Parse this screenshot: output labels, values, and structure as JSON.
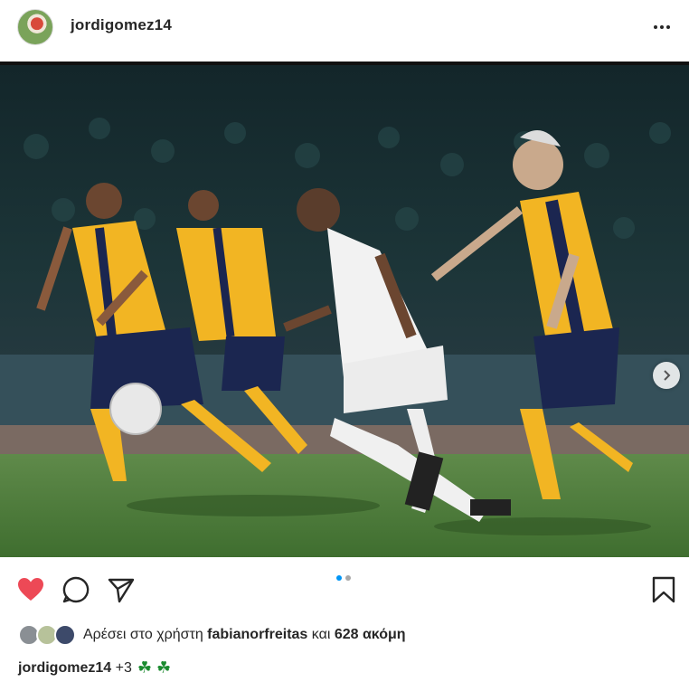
{
  "post": {
    "username": "jordigomez14",
    "more_icon": "more-horizontal-icon",
    "image_alt": "Football match photo",
    "carousel": {
      "current": 1,
      "total": 2
    }
  },
  "actions": {
    "like_icon": "heart-filled-icon",
    "comment_icon": "comment-icon",
    "share_icon": "paper-plane-icon",
    "save_icon": "bookmark-icon",
    "like_color": "#ed4956"
  },
  "likes": {
    "prefix": "Αρέσει στο χρήστη",
    "user": "fabianorfreitas",
    "conj": "και",
    "others": "628 ακόμη"
  },
  "caption": {
    "username": "jordigomez14",
    "text": "+3",
    "emoji": "☘ ☘"
  },
  "colors": {
    "accent": "#0095f6",
    "text": "#262626",
    "yellow_kit": "#f2b523",
    "navy_kit": "#1b2650"
  }
}
